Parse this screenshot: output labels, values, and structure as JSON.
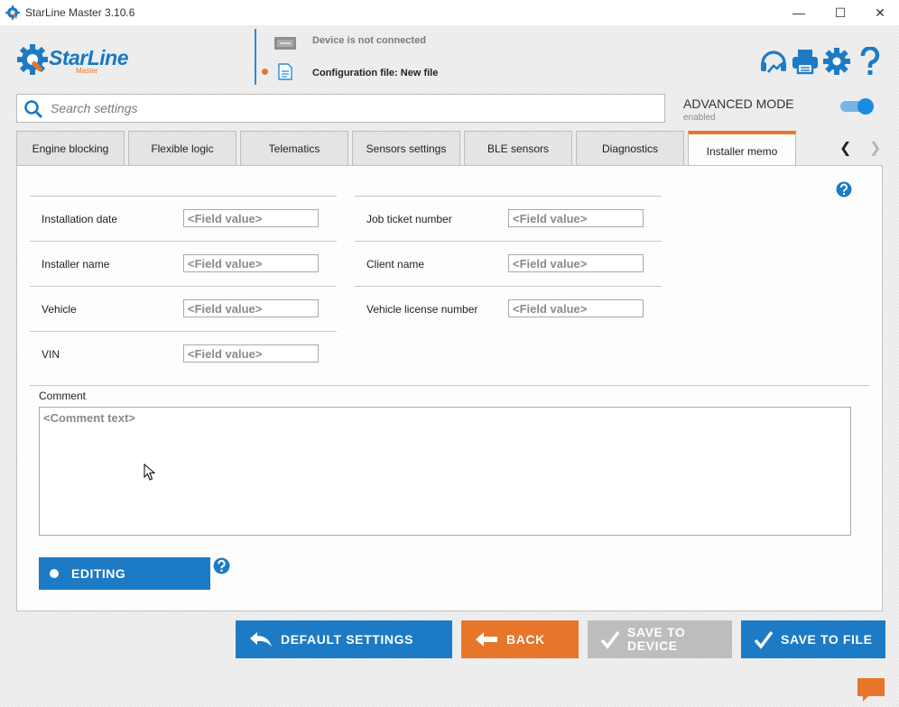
{
  "window": {
    "title": "StarLine Master 3.10.6",
    "minimize_glyph": "—",
    "maximize_glyph": "☐",
    "close_glyph": "✕"
  },
  "header": {
    "logo_text": "StarLine",
    "logo_sub": "Master",
    "device_status": "Device is not connected",
    "config_file": "Configuration file: New file",
    "icons": [
      "support-icon",
      "print-icon",
      "gear-icon",
      "help-icon"
    ]
  },
  "search": {
    "placeholder": "Search settings",
    "value": ""
  },
  "advanced_mode": {
    "label": "ADVANCED MODE",
    "status": "enabled",
    "on": true
  },
  "tabs": [
    {
      "label": "Engine blocking",
      "active": false
    },
    {
      "label": "Flexible logic",
      "active": false
    },
    {
      "label": "Telematics",
      "active": false
    },
    {
      "label": "Sensors settings",
      "active": false
    },
    {
      "label": "BLE sensors",
      "active": false
    },
    {
      "label": "Diagnostics",
      "active": false
    },
    {
      "label": "Installer memo",
      "active": true
    }
  ],
  "tab_nav": {
    "prev": "❮",
    "next": "❯"
  },
  "form": {
    "left": [
      {
        "label": "Installation date",
        "placeholder": "<Field value>",
        "value": ""
      },
      {
        "label": "Installer name",
        "placeholder": "<Field value>",
        "value": ""
      },
      {
        "label": "Vehicle",
        "placeholder": "<Field value>",
        "value": ""
      },
      {
        "label": "VIN",
        "placeholder": "<Field value>",
        "value": ""
      }
    ],
    "right": [
      {
        "label": "Job ticket number",
        "placeholder": "<Field value>",
        "value": ""
      },
      {
        "label": "Client name",
        "placeholder": "<Field value>",
        "value": ""
      },
      {
        "label": "Vehicle license number",
        "placeholder": "<Field value>",
        "value": ""
      }
    ],
    "comment_label": "Comment",
    "comment_placeholder": "<Comment text>",
    "editing_label": "EDITING"
  },
  "buttons": {
    "default_settings": "DEFAULT SETTINGS",
    "back": "BACK",
    "save_to_device_1": "SAVE TO",
    "save_to_device_2": "DEVICE",
    "save_to_file": "SAVE TO FILE"
  },
  "colors": {
    "accent": "#1d7bc6",
    "orange": "#e8762a",
    "disabled": "#bdbdbd"
  }
}
